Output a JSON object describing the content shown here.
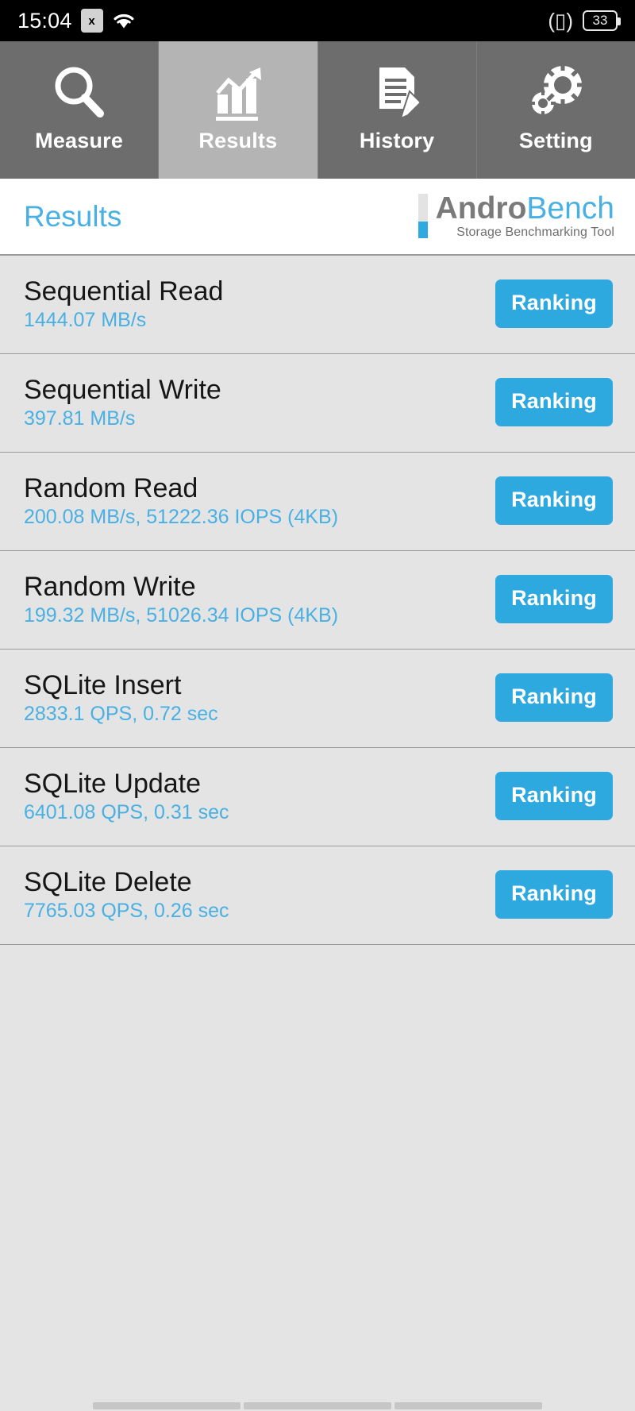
{
  "statusbar": {
    "time": "15:04",
    "sim_label": "x",
    "sim_icon": "sim-card-icon",
    "wifi_icon": "wifi-icon",
    "vibrate_icon": "vibrate-icon",
    "battery_level": "33"
  },
  "tabs": [
    {
      "label": "Measure",
      "icon": "magnifier-icon",
      "active": false
    },
    {
      "label": "Results",
      "icon": "bar-chart-icon",
      "active": true
    },
    {
      "label": "History",
      "icon": "document-pen-icon",
      "active": false
    },
    {
      "label": "Setting",
      "icon": "gears-icon",
      "active": false
    }
  ],
  "header": {
    "title": "Results",
    "logo_primary": "Andro",
    "logo_secondary": "Bench",
    "logo_tagline": "Storage Benchmarking Tool"
  },
  "results": [
    {
      "name": "Sequential Read",
      "value": "1444.07 MB/s",
      "button": "Ranking"
    },
    {
      "name": "Sequential Write",
      "value": "397.81 MB/s",
      "button": "Ranking"
    },
    {
      "name": "Random Read",
      "value": "200.08 MB/s, 51222.36 IOPS (4KB)",
      "button": "Ranking"
    },
    {
      "name": "Random Write",
      "value": "199.32 MB/s, 51026.34 IOPS (4KB)",
      "button": "Ranking"
    },
    {
      "name": "SQLite Insert",
      "value": "2833.1 QPS, 0.72 sec",
      "button": "Ranking"
    },
    {
      "name": "SQLite Update",
      "value": "6401.08 QPS, 0.31 sec",
      "button": "Ranking"
    },
    {
      "name": "SQLite Delete",
      "value": "7765.03 QPS, 0.26 sec",
      "button": "Ranking"
    }
  ],
  "colors": {
    "accent_blue": "#2ea9e0",
    "value_blue": "#49b0e4",
    "tabbar_inactive": "#6d6d6d",
    "tabbar_active": "#b4b4b4",
    "list_background": "#e4e4e4"
  }
}
